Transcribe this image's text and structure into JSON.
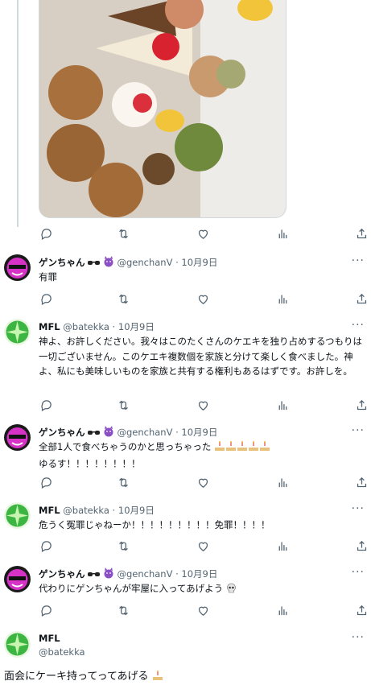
{
  "colors": {
    "accent": "#1d9bf0",
    "text": "#0f1419",
    "muted": "#536471",
    "line": "#cfd9de"
  },
  "tweets": [
    {
      "name": "ゲンちゃん",
      "handle": "@genchanV",
      "date": "10月9日",
      "text": "有罪",
      "badges": [
        "sunglasses",
        "smiling-devil"
      ]
    },
    {
      "name": "MFL",
      "handle": "@batekka",
      "date": "10月9日",
      "text": "神よ、お許しください。我々はこのたくさんのケエキを独り占めするつもりは一切ございません。このケエキ複数個を家族と分けて楽しく食べました。神よ、私にも美味しいものを家族と共有する権利もあるはずです。お許しを。"
    },
    {
      "name": "ゲンちゃん",
      "handle": "@genchanV",
      "date": "10月9日",
      "text1": "全部1人で食べちゃうのかと思っちゃった",
      "text2": "ゆるす！！！！！！！！",
      "badges": [
        "sunglasses",
        "smiling-devil"
      ]
    },
    {
      "name": "MFL",
      "handle": "@batekka",
      "date": "10月9日",
      "text": "危うく冤罪じゃねーか！！！！！！！！！免罪！！！！"
    },
    {
      "name": "ゲンちゃん",
      "handle": "@genchanV",
      "date": "10月9日",
      "text": "代わりにゲンちゃんが牢屋に入ってあげよう",
      "badges": [
        "sunglasses",
        "smiling-devil"
      ]
    }
  ],
  "main_tweet": {
    "name": "MFL",
    "handle": "@batekka",
    "text": "面会にケーキ持ってってあげる"
  },
  "icons": [
    "reply-icon",
    "retweet-icon",
    "like-icon",
    "views-icon",
    "share-icon",
    "more-icon",
    "cake-emoji",
    "skull-emoji"
  ]
}
